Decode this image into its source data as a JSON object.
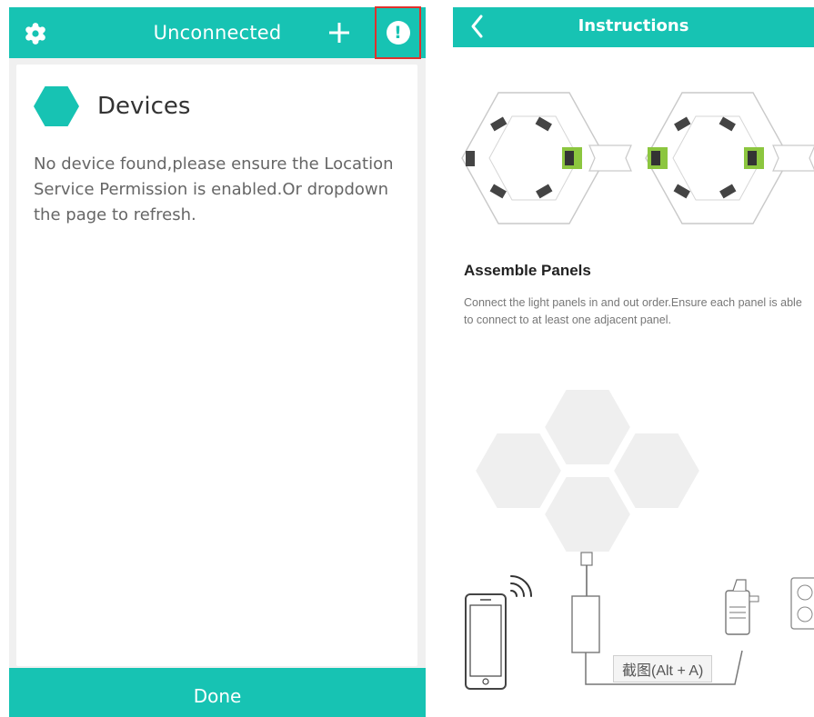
{
  "left_screen": {
    "header": {
      "title": "Unconnected",
      "settings_icon": "gear-icon",
      "add_icon": "plus-icon",
      "info_icon": "info-alert-icon"
    },
    "devices": {
      "section_label": "Devices",
      "empty_message": "No device found,please ensure the Location Service Permission is enabled.Or dropdown the page to refresh."
    },
    "footer": {
      "done_label": "Done"
    }
  },
  "right_screen": {
    "header": {
      "title": "Instructions",
      "back_icon": "chevron-left-icon"
    },
    "assemble": {
      "title": "Assemble Panels",
      "description": "Connect the light panels in and out order.Ensure each panel is able to connect to at least one adjacent panel."
    },
    "watermark": "截图(Alt + A)"
  },
  "colors": {
    "accent": "#17c3b3",
    "highlight_border": "#e0312c",
    "connector_green": "#8cc63f"
  }
}
